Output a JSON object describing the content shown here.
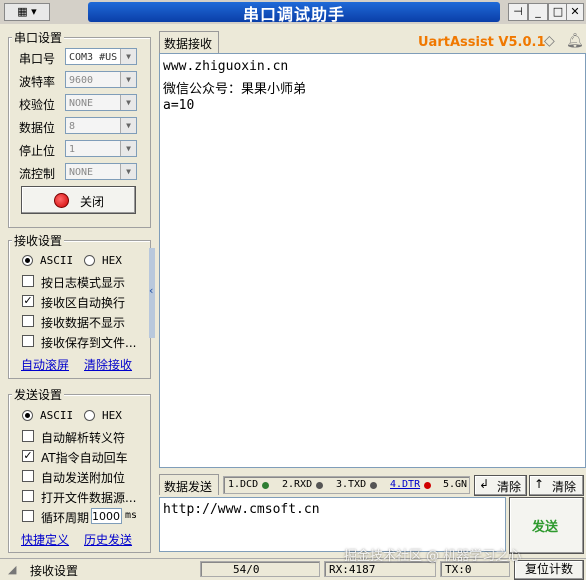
{
  "window": {
    "title": "串口调试助手",
    "menu_icon": "window-menu-icon"
  },
  "serial_settings": {
    "legend": "串口设置",
    "port": {
      "label": "串口号",
      "value": "COM3 #US"
    },
    "baud": {
      "label": "波特率",
      "value": "9600"
    },
    "parity": {
      "label": "校验位",
      "value": "NONE"
    },
    "data_bits": {
      "label": "数据位",
      "value": "8"
    },
    "stop_bits": {
      "label": "停止位",
      "value": "1"
    },
    "flow": {
      "label": "流控制",
      "value": "NONE"
    },
    "close_button": "关闭"
  },
  "receive_settings": {
    "legend": "接收设置",
    "ascii": "ASCII",
    "hex": "HEX",
    "options": [
      {
        "label": "按日志模式显示",
        "checked": false
      },
      {
        "label": "接收区自动换行",
        "checked": true
      },
      {
        "label": "接收数据不显示",
        "checked": false
      },
      {
        "label": "接收保存到文件...",
        "checked": false
      }
    ],
    "auto_scroll": "自动滚屏",
    "clear_receive": "清除接收"
  },
  "send_settings": {
    "legend": "发送设置",
    "ascii": "ASCII",
    "hex": "HEX",
    "options": [
      {
        "label": "自动解析转义符",
        "checked": false
      },
      {
        "label": "AT指令自动回车",
        "checked": true
      },
      {
        "label": "自动发送附加位",
        "checked": false
      },
      {
        "label": "打开文件数据源...",
        "checked": false
      },
      {
        "label": "循环周期",
        "checked": false
      }
    ],
    "period_value": "1000",
    "period_unit": "ms",
    "shortcut": "快捷定义",
    "history": "历史发送"
  },
  "receive_area": {
    "tab": "数据接收",
    "brand": "UartAssist V5.0.1",
    "lines": [
      "www.zhiguoxin.cn",
      "微信公众号：果果小师弟",
      "a=10"
    ]
  },
  "send_area": {
    "tab": "数据发送",
    "signals": [
      {
        "label": "1.DCD",
        "color": "#2e7d32"
      },
      {
        "label": "2.RXD",
        "color": "#555555"
      },
      {
        "label": "3.TXD",
        "color": "#555555"
      },
      {
        "label": "4.DTR",
        "color": "#d00000"
      },
      {
        "label": "5.GN",
        "color": ""
      }
    ],
    "clear_label": "清除",
    "clear2_label": "清除",
    "text": "http://www.cmsoft.cn",
    "send_button": "发送"
  },
  "status": {
    "label": "接收设置",
    "ratio": "54/0",
    "rx": "RX:4187",
    "tx": "TX:0",
    "reset": "复位计数"
  },
  "watermark": "掘金技术社区 @ 机器学习之心"
}
